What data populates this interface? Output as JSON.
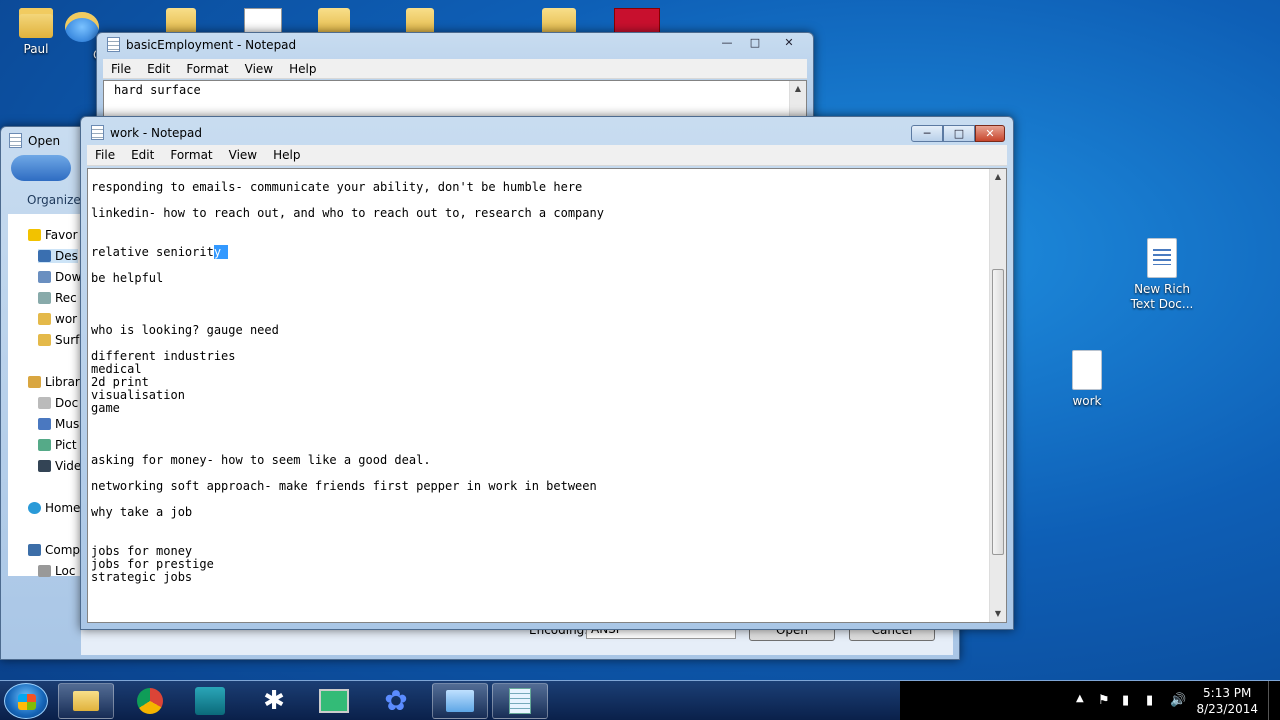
{
  "desktop": {
    "icons": [
      {
        "label": "Paul"
      },
      {
        "label": "Qu"
      },
      {
        "label": "New Rich Text Doc..."
      },
      {
        "label": "work"
      }
    ]
  },
  "back_window": {
    "title": "basicEmployment - Notepad",
    "menu": [
      "File",
      "Edit",
      "Format",
      "View",
      "Help"
    ],
    "text": "hard surface"
  },
  "open_dialog": {
    "title": "Open",
    "organize": "Organize",
    "nav": [
      "Favor",
      "Des",
      "Dow",
      "Rec",
      "wor",
      "Surf",
      "Librar",
      "Doc",
      "Mus",
      "Pict",
      "Vide",
      "Home",
      "Comp",
      "Loc"
    ],
    "encoding_label": "Encoding:",
    "encoding_value": "ANSI",
    "open_btn": "Open",
    "cancel_btn": "Cancel"
  },
  "front_window": {
    "title": "work - Notepad",
    "menu": [
      "File",
      "Edit",
      "Format",
      "View",
      "Help"
    ],
    "lines": [
      "responding to emails- communicate your ability, don't be humble here",
      "",
      "linkedin- how to reach out, and who to reach out to, research a company",
      "",
      "",
      "relative seniorit",
      "",
      "be helpful",
      "",
      "",
      "",
      "who is looking? gauge need",
      "",
      "different industries",
      "medical",
      "2d print",
      "visualisation",
      "game",
      "",
      "",
      "",
      "asking for money- how to seem like a good deal.",
      "",
      "networking soft approach- make friends first pepper in work in between",
      "",
      "why take a job",
      "",
      "",
      "jobs for money",
      "jobs for prestige",
      "strategic jobs"
    ],
    "selected_text": "y"
  },
  "taskbar": {
    "time": "5:13 PM",
    "date": "8/23/2014"
  }
}
